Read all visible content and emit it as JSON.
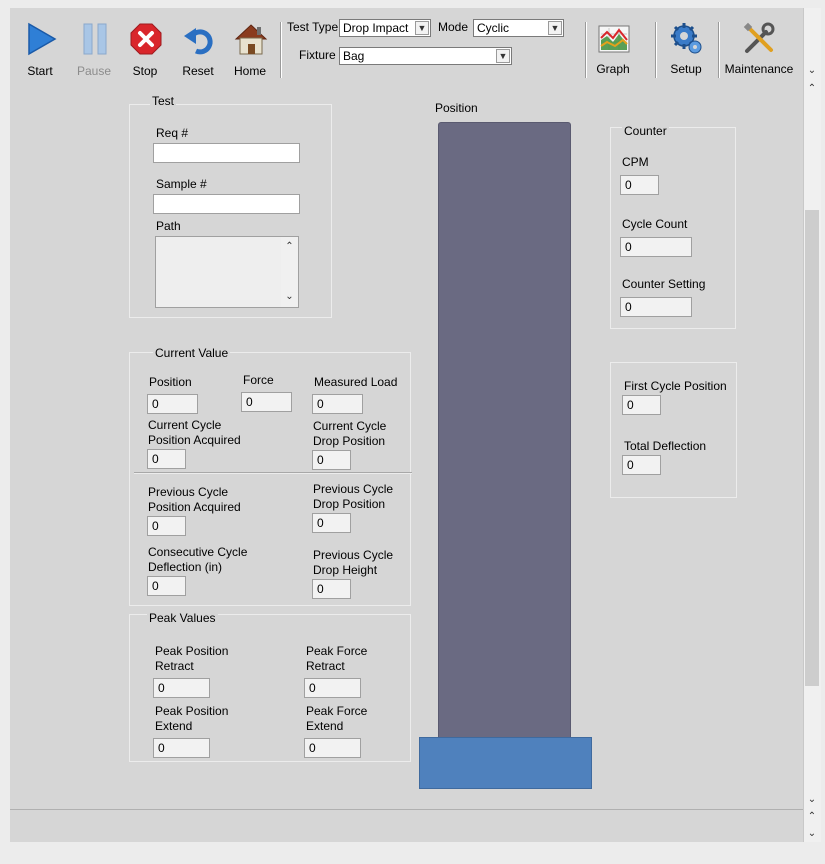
{
  "toolbar": {
    "buttons": [
      {
        "label": "Start",
        "icon": "play-icon",
        "enabled": true
      },
      {
        "label": "Pause",
        "icon": "pause-icon",
        "enabled": false
      },
      {
        "label": "Stop",
        "icon": "stop-icon",
        "enabled": true
      },
      {
        "label": "Reset",
        "icon": "reset-icon",
        "enabled": true
      },
      {
        "label": "Home",
        "icon": "home-icon",
        "enabled": true
      }
    ],
    "test_type_label": "Test Type",
    "test_type_value": "Drop Impact",
    "mode_label": "Mode",
    "mode_value": "Cyclic",
    "fixture_label": "Fixture",
    "fixture_value": "Bag",
    "graph_label": "Graph",
    "setup_label": "Setup",
    "maintenance_label": "Maintenance"
  },
  "test_group": {
    "title": "Test",
    "req_label": "Req #",
    "req_value": "",
    "sample_label": "Sample #",
    "sample_value": "",
    "path_label": "Path",
    "path_value": ""
  },
  "current_value": {
    "title": "Current Value",
    "position_label": "Position",
    "position_value": "0",
    "force_label": "Force",
    "force_value": "0",
    "measured_load_label": "Measured Load",
    "measured_load_value": "0",
    "ccpa_label_1": "Current Cycle",
    "ccpa_label_2": "Position Acquired",
    "ccpa_value": "0",
    "ccdp_label_1": "Current Cycle",
    "ccdp_label_2": "Drop Position",
    "ccdp_value": "0",
    "pcpa_label_1": "Previous Cycle",
    "pcpa_label_2": "Position Acquired",
    "pcpa_value": "0",
    "pcdp_label_1": "Previous Cycle",
    "pcdp_label_2": "Drop Position",
    "pcdp_value": "0",
    "ccd_label_1": "Consecutive Cycle",
    "ccd_label_2": "Deflection (in)",
    "ccd_value": "0",
    "pcdh_label_1": "Previous Cycle",
    "pcdh_label_2": "Drop Height",
    "pcdh_value": "0"
  },
  "peak_values": {
    "title": "Peak Values",
    "ppr_label_1": "Peak Position",
    "ppr_label_2": "Retract",
    "ppr_value": "0",
    "pfr_label_1": "Peak Force",
    "pfr_label_2": "Retract",
    "pfr_value": "0",
    "ppe_label_1": "Peak Position",
    "ppe_label_2": "Extend",
    "ppe_value": "0",
    "pfe_label_1": "Peak Force",
    "pfe_label_2": "Extend",
    "pfe_value": "0"
  },
  "position_indicator": {
    "label": "Position",
    "bar_color": "#6a6a82",
    "base_color": "#4f81bd"
  },
  "counter": {
    "title": "Counter",
    "cpm_label": "CPM",
    "cpm_value": "0",
    "cycle_count_label": "Cycle Count",
    "cycle_count_value": "0",
    "counter_setting_label": "Counter Setting",
    "counter_setting_value": "0"
  },
  "deflection": {
    "first_cycle_position_label": "First Cycle Position",
    "first_cycle_position_value": "0",
    "total_deflection_label": "Total Deflection",
    "total_deflection_value": "0"
  }
}
